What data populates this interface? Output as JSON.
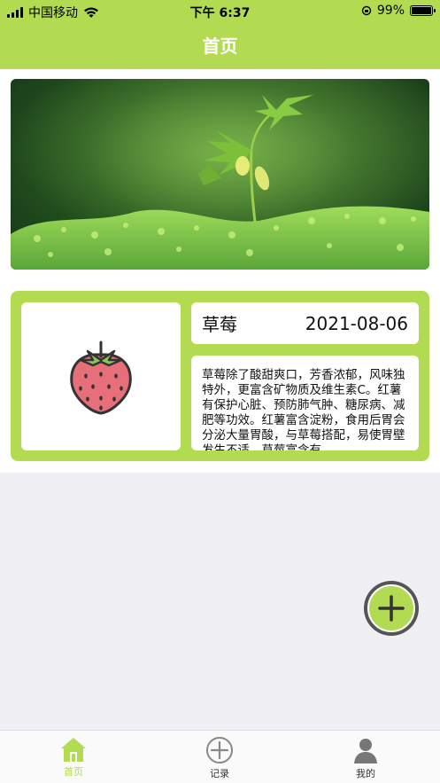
{
  "status_bar": {
    "carrier": "中国移动",
    "time": "下午 6:37",
    "battery_percent": "99%",
    "battery_level": 0.99
  },
  "header": {
    "title": "首页"
  },
  "record": {
    "name": "草莓",
    "date": "2021-08-06",
    "description": "草莓除了酸甜爽口，芳香浓郁，风味独特外，更富含矿物质及维生素C。红薯有保护心脏、预防肺气肿、糖尿病、减肥等功效。红薯富含淀粉，食用后胃会分泌大量胃酸，与草莓搭配，易使胃壁发生不适。草莓富含有",
    "image_icon": "strawberry-icon"
  },
  "fab": {
    "icon": "plus-icon"
  },
  "tabbar": {
    "items": [
      {
        "label": "首页",
        "icon": "home-icon"
      },
      {
        "label": "记录",
        "icon": "plus-circle-icon"
      },
      {
        "label": "我的",
        "icon": "user-icon"
      }
    ]
  },
  "colors": {
    "accent": "#b2db52",
    "background": "#f0eff4",
    "strawberry": "#e76f7a"
  }
}
